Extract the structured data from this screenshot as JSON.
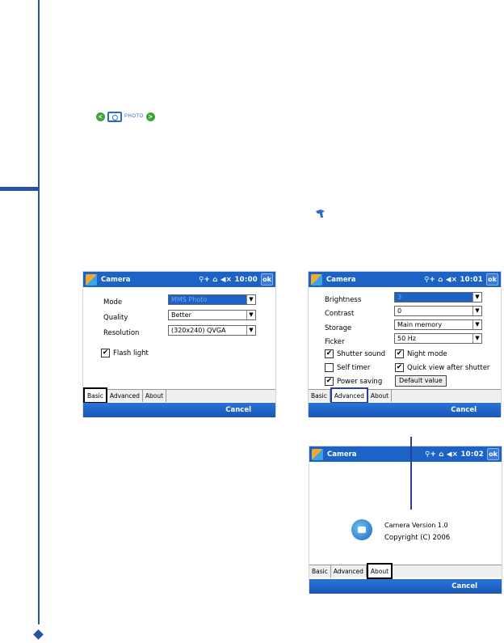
{
  "nav_icons": {
    "prev": "<",
    "next": ">",
    "photo_label": "PHOTO"
  },
  "screens": {
    "basic": {
      "title": "Camera",
      "status": "10:00",
      "ok": "ok",
      "fields": {
        "mode_label": "Mode",
        "mode_value": "MMS Photo",
        "quality_label": "Quality",
        "quality_value": "Better",
        "resolution_label": "Resolution",
        "resolution_value": "(320x240) QVGA"
      },
      "flash": {
        "label": "Flash light",
        "checked": true
      },
      "tabs": [
        "Basic",
        "Advanced",
        "About"
      ],
      "active_tab": "Basic",
      "cancel": "Cancel"
    },
    "advanced": {
      "title": "Camera",
      "status": "10:01",
      "ok": "ok",
      "fields": {
        "brightness_label": "Brightness",
        "brightness_value": "3",
        "contrast_label": "Contrast",
        "contrast_value": "0",
        "storage_label": "Storage",
        "storage_value": "Main memory",
        "flicker_label": "Ficker",
        "flicker_value": "50 Hz"
      },
      "checks": {
        "shutter_sound": "Shutter sound",
        "night_mode": "Night mode",
        "self_timer": "Self timer",
        "quick_view": "Quick view after shutter",
        "power_saving": "Power saving"
      },
      "default_button": "Default value",
      "tabs": [
        "Basic",
        "Advanced",
        "About"
      ],
      "active_tab": "Advanced",
      "cancel": "Cancel"
    },
    "about": {
      "title": "Camera",
      "status": "10:02",
      "ok": "ok",
      "version": "Camera Version 1.0",
      "copyright": "Copyright (C) 2006",
      "tabs": [
        "Basic",
        "Advanced",
        "About"
      ],
      "active_tab": "About",
      "cancel": "Cancel"
    }
  },
  "colors": {
    "accent": "#2a54a3",
    "titlebar": "#1d63c6"
  }
}
